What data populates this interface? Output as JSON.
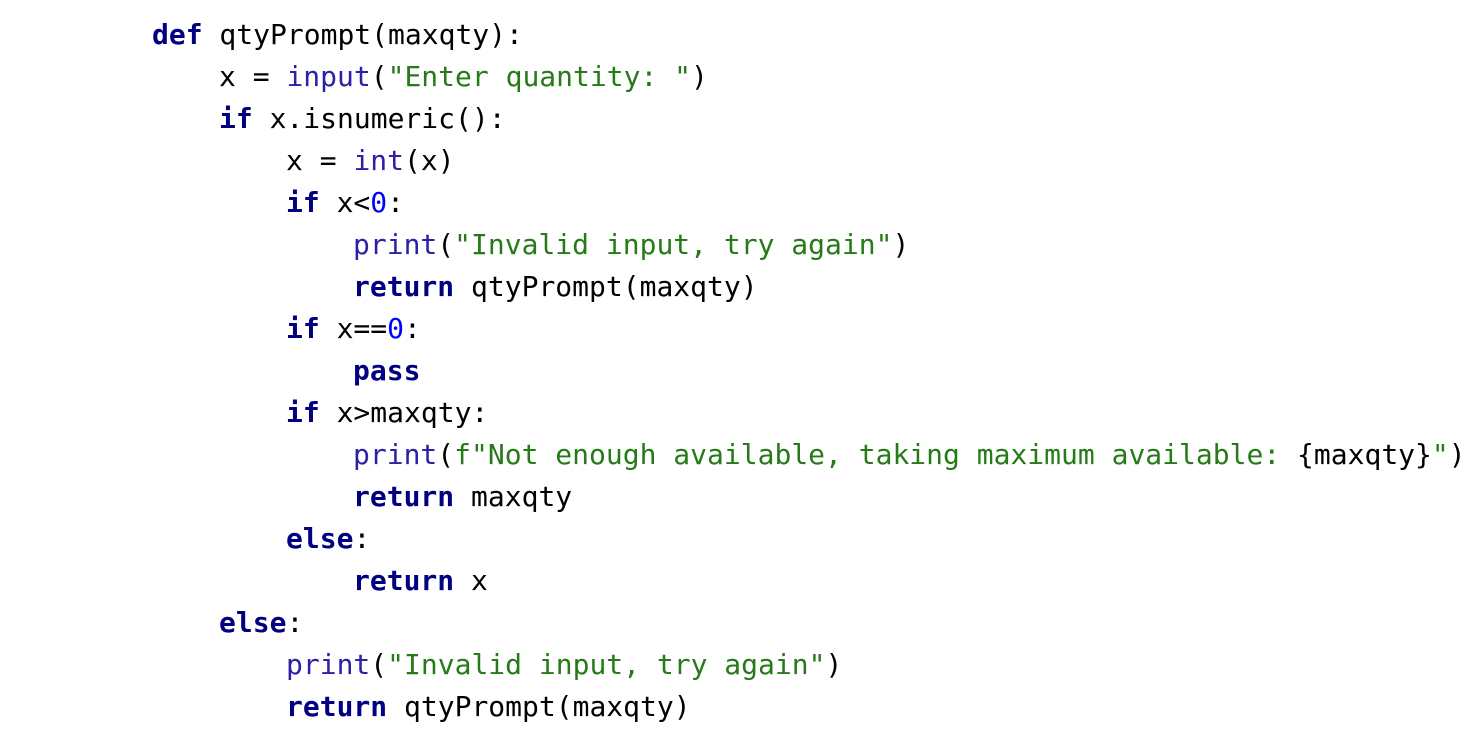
{
  "editor": {
    "language": "python",
    "colors": {
      "background": "#ffffff",
      "keyword": "#000080",
      "builtin": "#2c21a5",
      "string": "#267a18",
      "number": "#0000ff",
      "text": "#000000"
    },
    "lines": [
      {
        "indent": 0,
        "tokens": [
          {
            "type": "kw",
            "text": "def"
          },
          {
            "type": "plain",
            "text": " qtyPrompt(maxqty):"
          }
        ]
      },
      {
        "indent": 1,
        "tokens": [
          {
            "type": "plain",
            "text": "x = "
          },
          {
            "type": "bi",
            "text": "input"
          },
          {
            "type": "plain",
            "text": "("
          },
          {
            "type": "str",
            "text": "\"Enter quantity: \""
          },
          {
            "type": "plain",
            "text": ")"
          }
        ]
      },
      {
        "indent": 1,
        "tokens": [
          {
            "type": "kw",
            "text": "if"
          },
          {
            "type": "plain",
            "text": " x.isnumeric():"
          }
        ]
      },
      {
        "indent": 2,
        "tokens": [
          {
            "type": "plain",
            "text": "x = "
          },
          {
            "type": "bi",
            "text": "int"
          },
          {
            "type": "plain",
            "text": "(x)"
          }
        ]
      },
      {
        "indent": 2,
        "tokens": [
          {
            "type": "kw",
            "text": "if"
          },
          {
            "type": "plain",
            "text": " x<"
          },
          {
            "type": "num",
            "text": "0"
          },
          {
            "type": "plain",
            "text": ":"
          }
        ]
      },
      {
        "indent": 3,
        "tokens": [
          {
            "type": "bi",
            "text": "print"
          },
          {
            "type": "plain",
            "text": "("
          },
          {
            "type": "str",
            "text": "\"Invalid input, try again\""
          },
          {
            "type": "plain",
            "text": ")"
          }
        ]
      },
      {
        "indent": 3,
        "tokens": [
          {
            "type": "kw",
            "text": "return"
          },
          {
            "type": "plain",
            "text": " qtyPrompt(maxqty)"
          }
        ]
      },
      {
        "indent": 2,
        "tokens": [
          {
            "type": "kw",
            "text": "if"
          },
          {
            "type": "plain",
            "text": " x=="
          },
          {
            "type": "num",
            "text": "0"
          },
          {
            "type": "plain",
            "text": ":"
          }
        ]
      },
      {
        "indent": 3,
        "tokens": [
          {
            "type": "kw",
            "text": "pass"
          }
        ]
      },
      {
        "indent": 2,
        "tokens": [
          {
            "type": "kw",
            "text": "if"
          },
          {
            "type": "plain",
            "text": " x>maxqty:"
          }
        ]
      },
      {
        "indent": 3,
        "tokens": [
          {
            "type": "bi",
            "text": "print"
          },
          {
            "type": "plain",
            "text": "("
          },
          {
            "type": "str",
            "text": "f\"Not enough available, taking maximum available: "
          },
          {
            "type": "plain",
            "text": "{maxqty}"
          },
          {
            "type": "str",
            "text": "\""
          },
          {
            "type": "plain",
            "text": ")"
          }
        ]
      },
      {
        "indent": 3,
        "tokens": [
          {
            "type": "kw",
            "text": "return"
          },
          {
            "type": "plain",
            "text": " maxqty"
          }
        ]
      },
      {
        "indent": 2,
        "tokens": [
          {
            "type": "kw",
            "text": "else"
          },
          {
            "type": "plain",
            "text": ":"
          }
        ]
      },
      {
        "indent": 3,
        "tokens": [
          {
            "type": "kw",
            "text": "return"
          },
          {
            "type": "plain",
            "text": " x"
          }
        ]
      },
      {
        "indent": 1,
        "tokens": [
          {
            "type": "kw",
            "text": "else"
          },
          {
            "type": "plain",
            "text": ":"
          }
        ]
      },
      {
        "indent": 2,
        "tokens": [
          {
            "type": "bi",
            "text": "print"
          },
          {
            "type": "plain",
            "text": "("
          },
          {
            "type": "str",
            "text": "\"Invalid input, try again\""
          },
          {
            "type": "plain",
            "text": ")"
          }
        ]
      },
      {
        "indent": 2,
        "tokens": [
          {
            "type": "kw",
            "text": "return"
          },
          {
            "type": "plain",
            "text": " qtyPrompt(maxqty)"
          }
        ]
      }
    ]
  }
}
